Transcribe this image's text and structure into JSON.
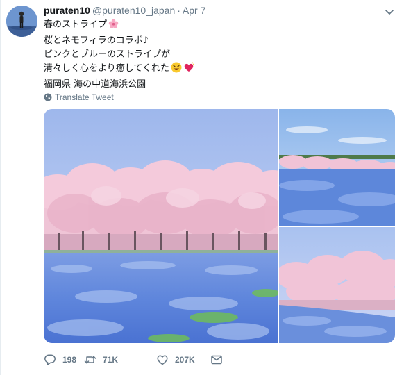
{
  "tweet": {
    "user": {
      "display_name": "puraten10",
      "handle": "@puraten10_japan",
      "separator": "·",
      "date": "Apr 7"
    },
    "text_lines": [
      "春のストライプ",
      "桜とネモフィラのコラボ♪",
      "ピンクとブルーのストライプが",
      "清々しく心をより癒してくれた",
      "福岡県 海の中道海浜公園"
    ],
    "translate_label": "Translate Tweet",
    "photos": [
      {
        "name": "cherry-blossom-nemophila-field"
      },
      {
        "name": "cherry-trees-over-blue-field"
      },
      {
        "name": "cherry-blossom-hillside"
      }
    ],
    "stats": {
      "replies": "198",
      "retweets": "71K",
      "likes": "207K"
    },
    "icons": {
      "reply": "reply-icon",
      "retweet": "retweet-icon",
      "like": "heart-icon",
      "dm": "envelope-icon",
      "more": "chevron-down-icon",
      "translate": "globe-icon"
    },
    "colors": {
      "text": "#14171a",
      "secondary": "#657786",
      "sakura": "#f3c2d6",
      "nemophila": "#6f97e6",
      "sky": "#b7cdf1"
    }
  }
}
